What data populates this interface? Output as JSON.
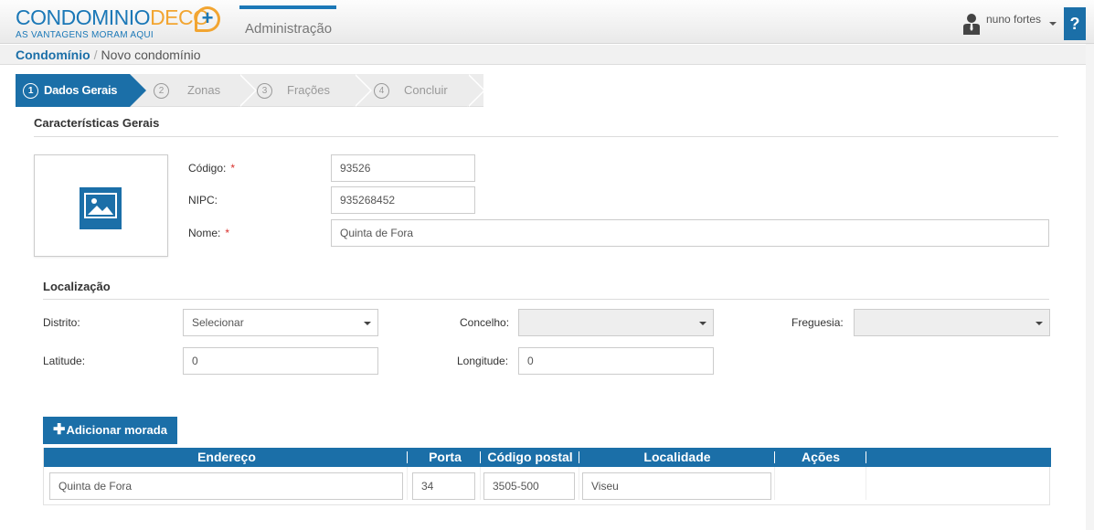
{
  "header": {
    "logo_main_a": "CONDOMINIO",
    "logo_main_b": "DECO",
    "logo_plus": "+",
    "logo_tagline": "AS VANTAGENS MORAM AQUI",
    "section": "Administração",
    "user_name": "nuno fortes",
    "help_label": "?"
  },
  "breadcrumb": {
    "root": "Condomínio",
    "separator": "/",
    "current": "Novo condomínio"
  },
  "wizard": {
    "steps": [
      {
        "num": "1",
        "label": "Dados Gerais",
        "active": true
      },
      {
        "num": "2",
        "label": "Zonas",
        "active": false
      },
      {
        "num": "3",
        "label": "Frações",
        "active": false
      },
      {
        "num": "4",
        "label": "Concluir",
        "active": false
      }
    ]
  },
  "general": {
    "title": "Características Gerais",
    "codigo_label": "Código:",
    "codigo_value": "93526",
    "nipc_label": "NIPC:",
    "nipc_value": "935268452",
    "nome_label": "Nome:",
    "nome_value": "Quinta de Fora",
    "required_mark": "*"
  },
  "location": {
    "title": "Localização",
    "distrito_label": "Distrito:",
    "distrito_value": "Selecionar",
    "concelho_label": "Concelho:",
    "concelho_value": "",
    "freguesia_label": "Freguesia:",
    "freguesia_value": "",
    "latitude_label": "Latitude:",
    "latitude_value": "0",
    "longitude_label": "Longitude:",
    "longitude_value": "0"
  },
  "addresses": {
    "add_button": "Adicionar morada",
    "add_plus": "✚",
    "columns": [
      "Endereço",
      "Porta",
      "Código postal",
      "Localidade",
      "Ações"
    ],
    "rows": [
      {
        "endereco": "Quinta de Fora",
        "porta": "34",
        "codigo_postal": "3505-500",
        "localidade": "Viseu"
      }
    ]
  },
  "colors": {
    "accent": "#1b6fa8",
    "logo_blue": "#1b78b7",
    "logo_orange": "#f2a531",
    "required": "#d9302c"
  }
}
